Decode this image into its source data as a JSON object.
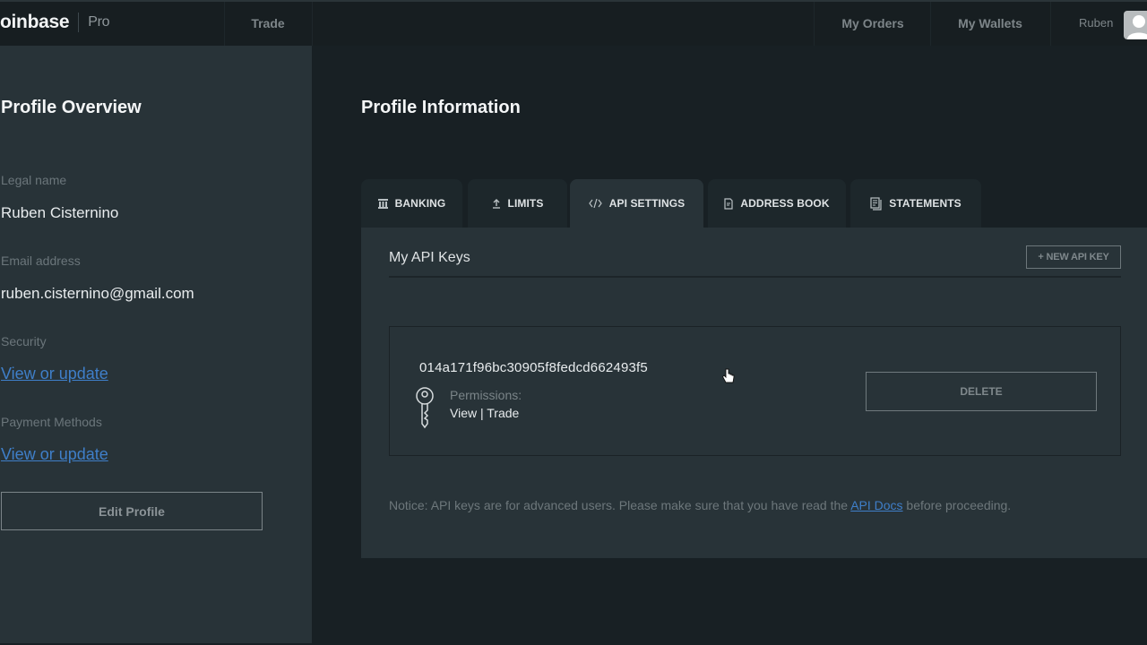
{
  "topnav": {
    "logo_text": "oinbase",
    "logo_suffix": "Pro",
    "trade": "Trade",
    "my_orders": "My Orders",
    "my_wallets": "My Wallets",
    "user_name": "Ruben",
    "avatar_icon": "user-avatar-icon"
  },
  "sidebar": {
    "title": "Profile Overview",
    "legal_name_label": "Legal name",
    "legal_name_value": "Ruben Cisternino",
    "email_label": "Email address",
    "email_value": "ruben.cisternino@gmail.com",
    "security_label": "Security",
    "security_link": "View or update",
    "payment_label": "Payment Methods",
    "payment_link": "View or update",
    "edit_button": "Edit Profile"
  },
  "main": {
    "title": "Profile Information",
    "tabs": [
      {
        "label": "BANKING",
        "icon": "bank-icon",
        "active": false
      },
      {
        "label": "LIMITS",
        "icon": "upload-arrow-icon",
        "active": false
      },
      {
        "label": "API SETTINGS",
        "icon": "code-icon",
        "active": true
      },
      {
        "label": "ADDRESS BOOK",
        "icon": "document-icon",
        "active": false
      },
      {
        "label": "STATEMENTS",
        "icon": "statements-icon",
        "active": false
      }
    ],
    "panel": {
      "title": "My API Keys",
      "new_key_button": "+ NEW API KEY",
      "keys": [
        {
          "id": "014a171f96bc30905f8fedcd662493f5",
          "permissions_label": "Permissions:",
          "permissions_value": "View | Trade",
          "delete_button": "DELETE"
        }
      ],
      "notice_before": "Notice: API keys are for advanced users. Please make sure that you have read the ",
      "notice_link": "API Docs",
      "notice_after": " before proceeding."
    }
  },
  "colors": {
    "background": "#182024",
    "panel": "#283338",
    "link": "#3f7fc9",
    "text": "#e8ecee",
    "muted": "#6d777b"
  }
}
